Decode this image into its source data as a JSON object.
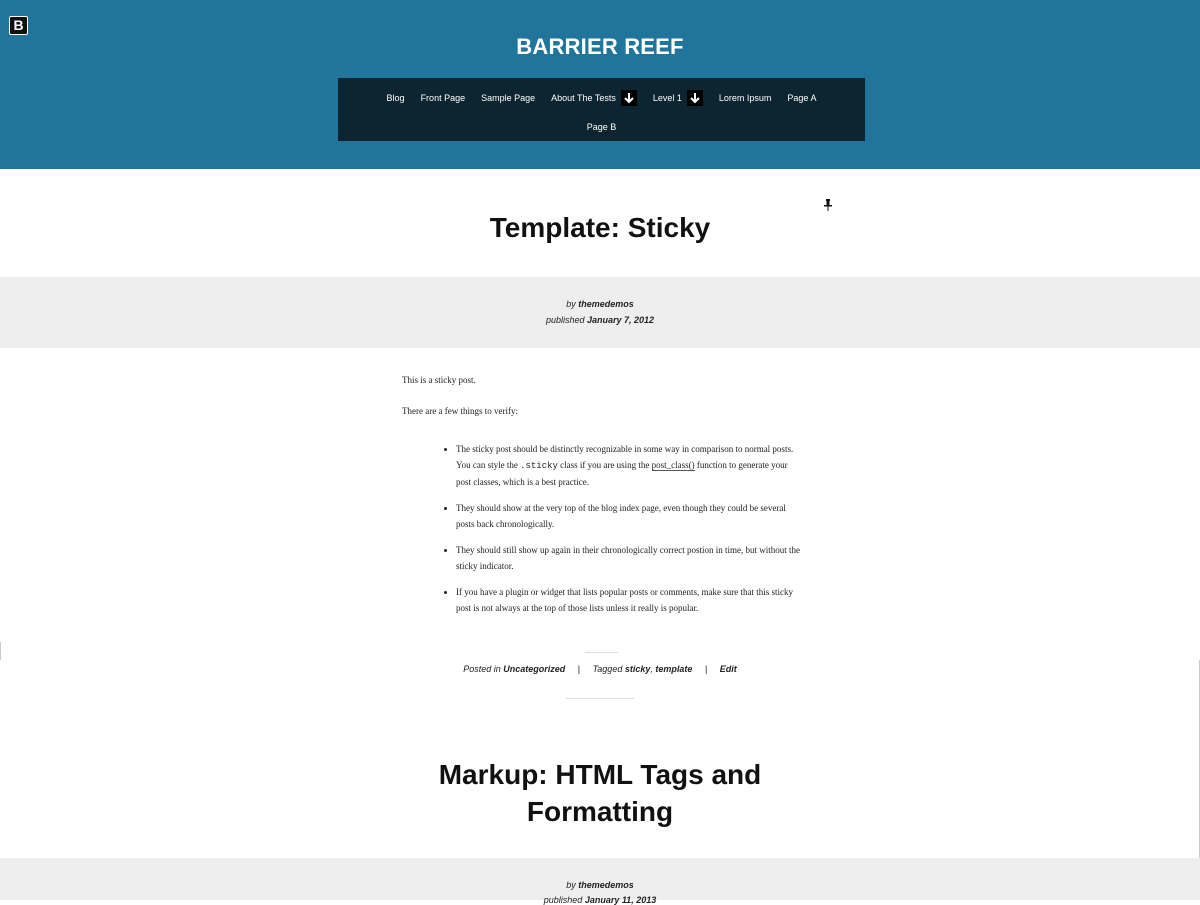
{
  "header": {
    "badge": "B",
    "site_title": "BARRIER REEF",
    "nav": {
      "row1": [
        {
          "label": "Blog",
          "has_dropdown": false
        },
        {
          "label": "Front Page",
          "has_dropdown": false
        },
        {
          "label": "Sample Page",
          "has_dropdown": false
        },
        {
          "label": "About The Tests",
          "has_dropdown": true
        },
        {
          "label": "Level 1",
          "has_dropdown": true
        },
        {
          "label": "Lorem Ipsum",
          "has_dropdown": false
        },
        {
          "label": "Page A",
          "has_dropdown": false
        }
      ],
      "row2": [
        {
          "label": "Page B",
          "has_dropdown": false
        }
      ]
    }
  },
  "post1": {
    "title": "Template: Sticky",
    "by_prefix": "by",
    "author": "themedemos",
    "published_prefix": "published",
    "date": "January 7, 2012",
    "intro1": "This is a sticky post.",
    "intro2": "There are a few things to verify:",
    "bullets": {
      "b1a": "The sticky post should be distinctly recognizable in some way in comparison to normal posts. You can style the ",
      "b1_code": ".sticky",
      "b1b": " class if you are using the ",
      "b1_link": "post_class()",
      "b1c": " function to generate your post classes, which is a best practice.",
      "b2": "They should show at the very top of the blog index page, even though they could be several posts back chronologically.",
      "b3": "They should still show up again in their chronologically correct postion in time, but without the sticky indicator.",
      "b4": "If you have a plugin or widget that lists popular posts or comments, make sure that this sticky post is not always at the top of those lists unless it really is popular."
    },
    "footer": {
      "posted_in_prefix": "Posted in",
      "category": "Uncategorized",
      "sep": "|",
      "tagged_prefix": "Tagged",
      "tag1": "sticky",
      "comma": ",",
      "tag2": "template",
      "edit": "Edit"
    }
  },
  "post2": {
    "title_line1": "Markup: HTML Tags and",
    "title_line2": "Formatting",
    "by_prefix": "by",
    "author": "themedemos",
    "published_prefix": "published",
    "date": "January 11, 2013"
  }
}
